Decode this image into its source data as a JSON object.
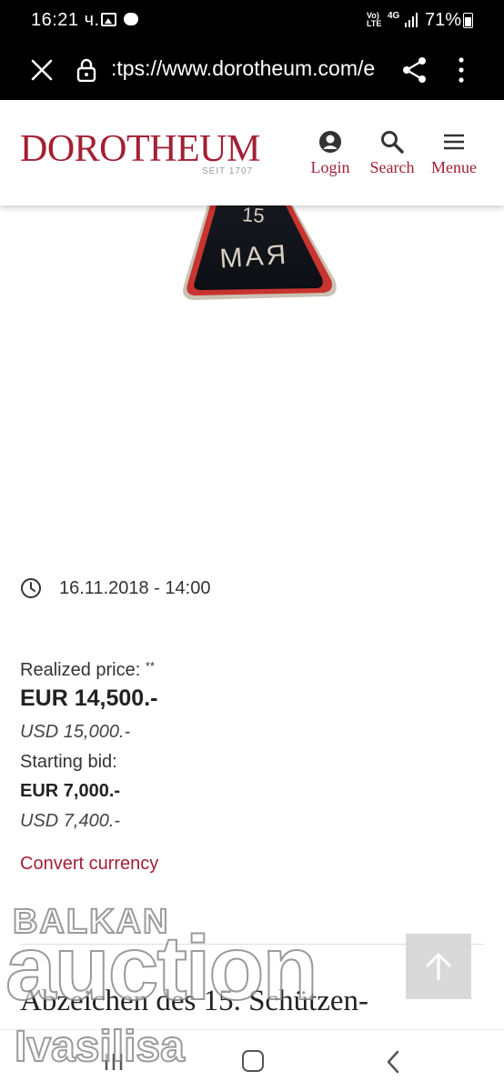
{
  "status_bar": {
    "time": "16:21 ч.",
    "network": "Vo) LTE",
    "network_type": "4G",
    "battery": "71%",
    "icons": [
      "image-icon",
      "message-icon",
      "signal-icon",
      "battery-icon"
    ]
  },
  "url_bar": {
    "url": ":tps://www.dorotheum.com/e",
    "icons": [
      "close-icon",
      "lock-icon",
      "share-icon",
      "more-vert-icon"
    ]
  },
  "header": {
    "logo": "DOROTHEUM",
    "logo_sub": "SEIT 1707",
    "nav": {
      "login": "Login",
      "search": "Search",
      "menu": "Menue"
    },
    "brand_color": "#a31f34"
  },
  "item": {
    "image_text_top": "15",
    "image_text_bottom": "МАЯ",
    "date": "16.11.2018 - 14:00",
    "realized_label": "Realized price:",
    "realized_mark": "**",
    "realized_eur": "EUR 14,500.-",
    "realized_usd": "USD 15,000.-",
    "starting_label": "Starting bid:",
    "starting_eur": "EUR 7,000.-",
    "starting_usd": "USD 7,400.-",
    "convert": "Convert currency",
    "title": "Abzeichen des 15. Schützen-"
  },
  "watermark": {
    "line1": "BALKAN",
    "line2": "auction",
    "line3": "Ivasilisa"
  }
}
